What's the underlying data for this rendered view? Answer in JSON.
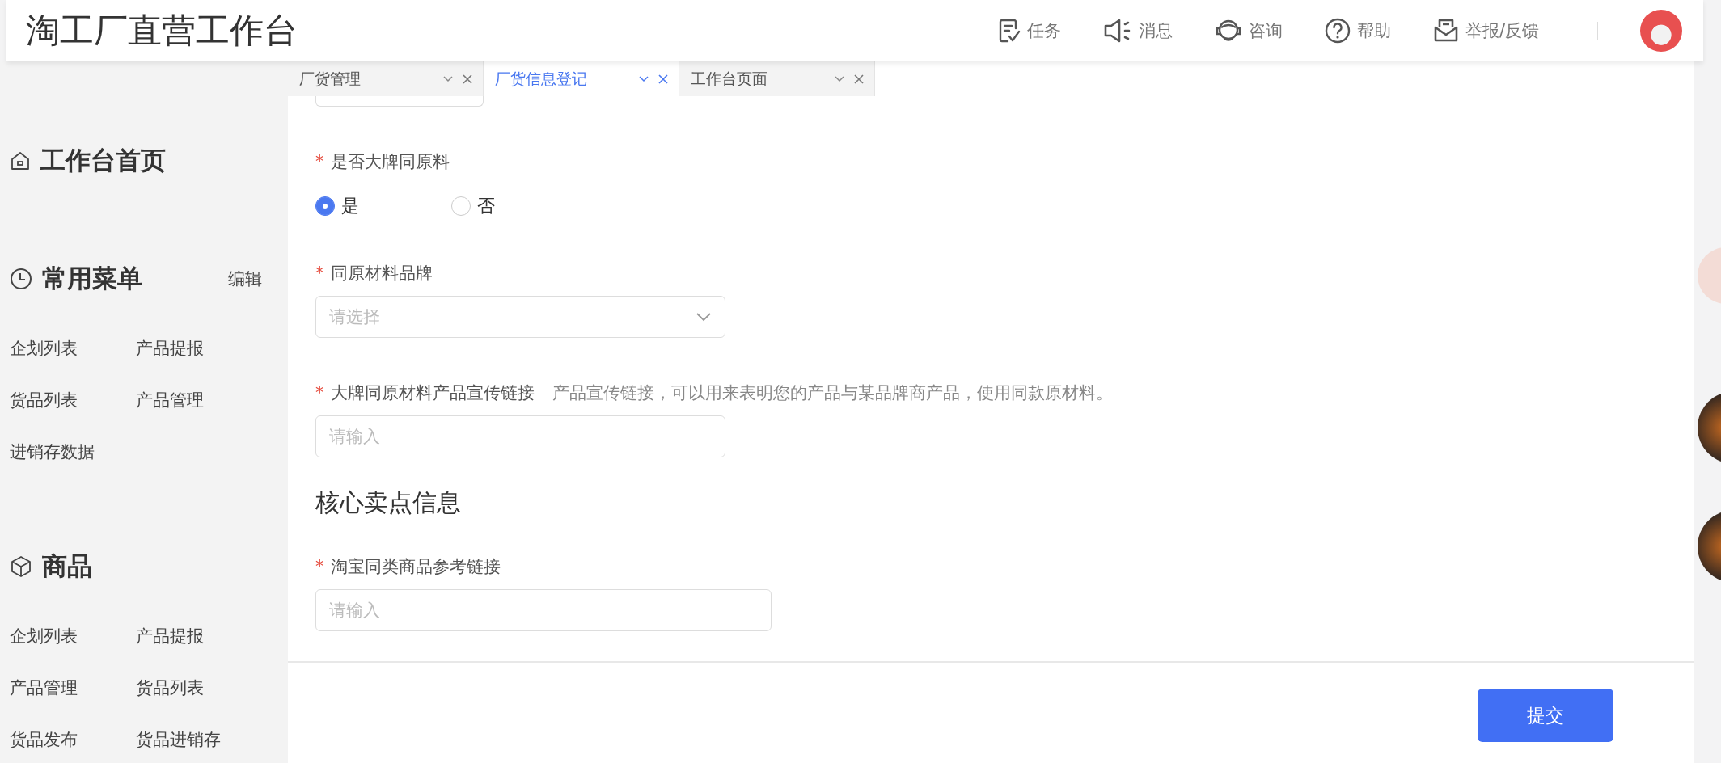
{
  "header": {
    "title": "淘工厂直营工作台",
    "actions": [
      {
        "label": "任务"
      },
      {
        "label": "消息"
      },
      {
        "label": "咨询"
      },
      {
        "label": "帮助"
      },
      {
        "label": "举报/反馈"
      }
    ]
  },
  "sidebar": {
    "sections": [
      {
        "title": "工作台首页"
      },
      {
        "title": "常用菜单",
        "action": "编辑",
        "items": [
          "企划列表",
          "产品提报",
          "货品列表",
          "产品管理",
          "进销存数据"
        ]
      },
      {
        "title": "商品",
        "items": [
          "企划列表",
          "产品提报",
          "产品管理",
          "货品列表",
          "货品发布",
          "货品进销存"
        ]
      }
    ]
  },
  "tabs": [
    {
      "label": "厂货管理",
      "selected": false
    },
    {
      "label": "厂货信息登记",
      "selected": true
    },
    {
      "label": "工作台页面",
      "selected": false
    }
  ],
  "form": [
    {
      "kind": "radio",
      "mark": "*",
      "label": "是否大牌同原料",
      "options": [
        {
          "label": "是",
          "selected": true
        },
        {
          "label": "否",
          "selected": false
        }
      ]
    },
    {
      "kind": "select",
      "mark": "*",
      "label": "同原材料品牌",
      "placeholder": "请选择"
    },
    {
      "kind": "input",
      "mark": "*",
      "label": "大牌同原材料产品宣传链接",
      "hint": "产品宣传链接，可以用来表明您的产品与某品牌商产品，使用同款原材料。",
      "placeholder": "请输入"
    },
    {
      "kind": "heading",
      "label": "核心卖点信息"
    },
    {
      "kind": "input",
      "mark": "*",
      "label": "淘宝同类商品参考链接",
      "placeholder": "请输入",
      "wide": true
    }
  ],
  "footer": {
    "submit": "提交"
  }
}
